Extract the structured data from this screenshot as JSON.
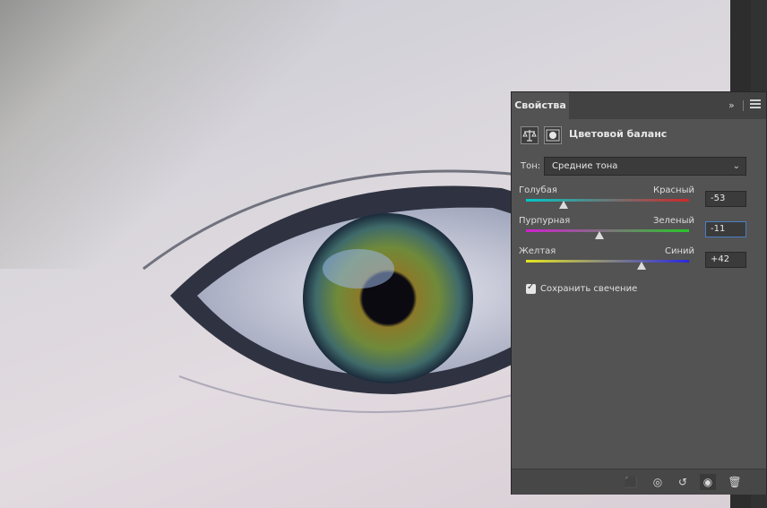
{
  "panel": {
    "tab_label": "Свойства",
    "collapse_icon": "double-chevron-right-icon",
    "menu_icon": "hamburger-menu-icon",
    "adjustment_title": "Цветовой баланс",
    "tone_label": "Тон:",
    "tone_value": "Средние тона",
    "sliders": [
      {
        "left": "Голубая",
        "right": "Красный",
        "value": "-53",
        "position": 0.23,
        "from": "#00c8c8",
        "to": "#d02828"
      },
      {
        "left": "Пурпурная",
        "right": "Зеленый",
        "value": "-11",
        "position": 0.45,
        "from": "#d020d0",
        "to": "#28c828"
      },
      {
        "left": "Желтая",
        "right": "Синий",
        "value": "+42",
        "position": 0.71,
        "from": "#e6e620",
        "to": "#2828e0"
      }
    ],
    "preserve_luminosity": {
      "label": "Сохранить свечение",
      "checked": true
    }
  },
  "colors": {
    "panel_bg": "#535353",
    "header_bg": "#424242",
    "focus_border": "#4a7fc3"
  }
}
